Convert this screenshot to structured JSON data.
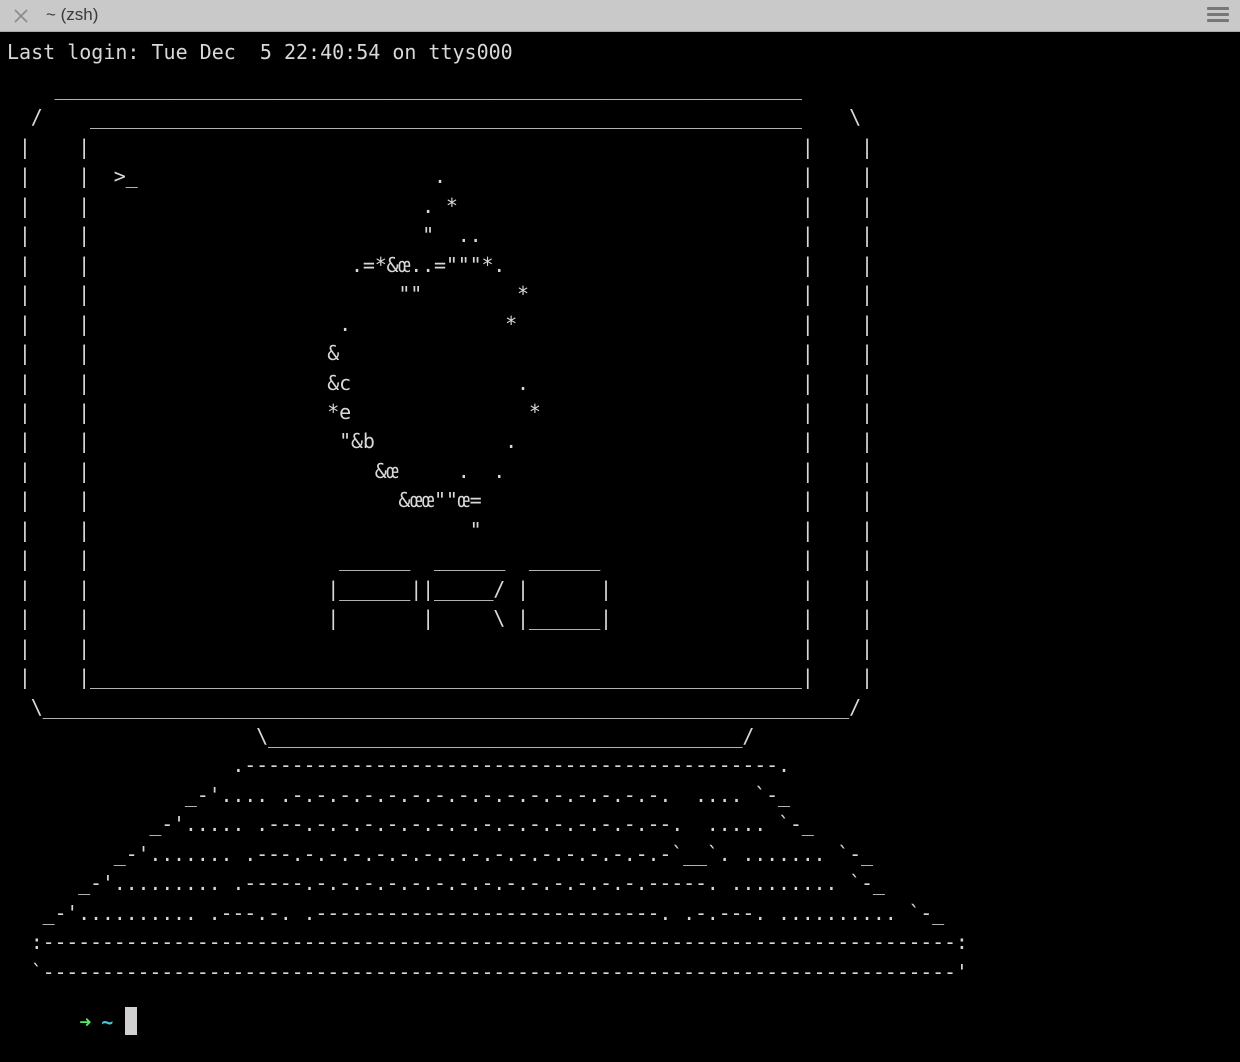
{
  "window": {
    "title": "~ (zsh)",
    "close_icon": "close-icon",
    "menu_icon": "hamburger-menu-icon"
  },
  "terminal": {
    "last_login": "Last login: Tue Dec  5 22:40:54 on ttys000",
    "ascii_art": "    _______________________________________________________________\n  /    ____________________________________________________________    \\\n |    |                                                            |    |\n |    |  >_                         .                              |    |\n |    |                            . *                             |    |\n |    |                            \"  ..                           |    |\n |    |                      .=*&œ..=\"\"\"*.                         |    |\n |    |                          \"\"        *                       |    |\n |    |                     .             *                        |    |\n |    |                    &                                       |    |\n |    |                    &c              .                       |    |\n |    |                    *e               *                      |    |\n |    |                     \"&b           .                        |    |\n |    |                        &œ     .  .                         |    |\n |    |                          &œœ\"\"œ=                           |    |\n |    |                                \"                           |    |\n |    |                     ______  ______  ______                 |    |\n |    |                    |______||_____/ |      |                |    |\n |    |                    |       |     \\ |______|                |    |\n |    |                                                            |    |\n |    |____________________________________________________________|    |\n  \\____________________________________________________________________/\n                     \\________________________________________/\n                   .---------------------------------------------.\n               _-'.... .-.-.-.-.-.-.-.-.-.-.-.-.-.-.-.-.  .... `-_\n            _-'..... .---.-.-.-.-.-.-.-.-.-.-.-.-.-.-.--.  ..... `-_\n         _-'....... .---.-.-.-.-.-.-.-.-.-.-.-.-.-.-.-.-`__`. ....... `-_\n      _-'......... .-----.-.-.-.-.-.-.-.-.-.-.-.-.-.-.-----. ......... `-_\n   _-'.......... .---.-. .-----------------------------. .-.---. .......... `-_\n  :-----------------------------------------------------------------------------:\n  `-----------------------------------------------------------------------------'",
    "prompt_arrow": "➜",
    "prompt_dir": "~"
  }
}
